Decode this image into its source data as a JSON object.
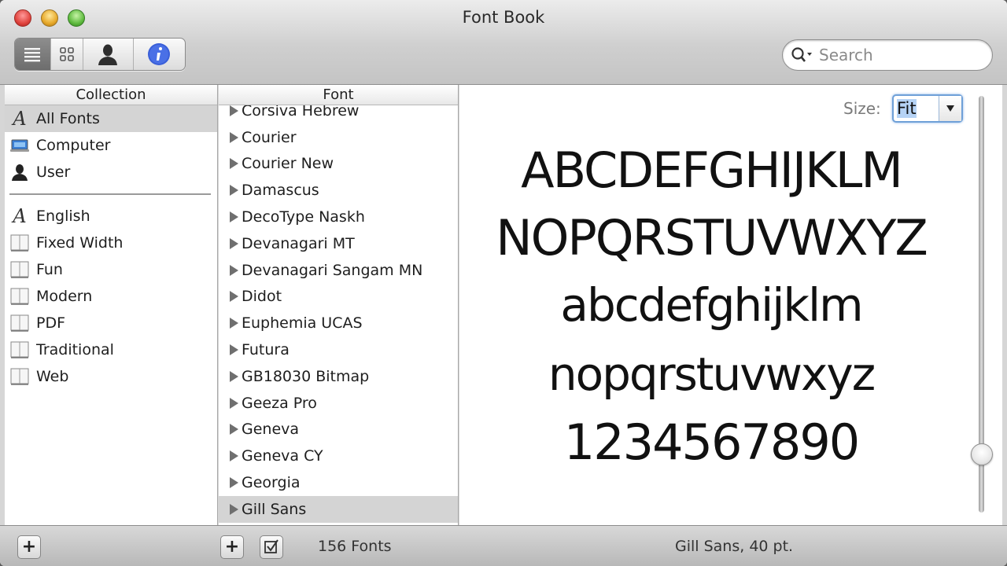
{
  "window": {
    "title": "Font Book"
  },
  "toolbar": {
    "view_buttons": [
      {
        "name": "list-view",
        "icon": "list-icon",
        "active": true
      },
      {
        "name": "grid-view",
        "icon": "grid-icon",
        "active": false
      },
      {
        "name": "user-view",
        "icon": "person-icon",
        "active": false
      },
      {
        "name": "info",
        "icon": "info-icon",
        "active": false
      }
    ],
    "search": {
      "placeholder": "Search",
      "value": ""
    }
  },
  "collection": {
    "header": "Collection",
    "items": [
      {
        "label": "All Fonts",
        "icon": "script-a-icon",
        "selected": true
      },
      {
        "label": "Computer",
        "icon": "computer-icon",
        "selected": false
      },
      {
        "label": "User",
        "icon": "user-icon",
        "selected": false
      }
    ],
    "custom_items": [
      {
        "label": "English",
        "icon": "script-a-icon"
      },
      {
        "label": "Fixed Width",
        "icon": "collection-book-icon"
      },
      {
        "label": "Fun",
        "icon": "collection-book-icon"
      },
      {
        "label": "Modern",
        "icon": "collection-book-icon"
      },
      {
        "label": "PDF",
        "icon": "collection-book-icon"
      },
      {
        "label": "Traditional",
        "icon": "collection-book-icon"
      },
      {
        "label": "Web",
        "icon": "collection-book-icon"
      }
    ]
  },
  "fonts": {
    "header": "Font",
    "items": [
      {
        "label": "Corsiva Hebrew",
        "selected": false
      },
      {
        "label": "Courier",
        "selected": false
      },
      {
        "label": "Courier New",
        "selected": false
      },
      {
        "label": "Damascus",
        "selected": false
      },
      {
        "label": "DecoType Naskh",
        "selected": false
      },
      {
        "label": "Devanagari MT",
        "selected": false
      },
      {
        "label": "Devanagari Sangam MN",
        "selected": false
      },
      {
        "label": "Didot",
        "selected": false
      },
      {
        "label": "Euphemia UCAS",
        "selected": false
      },
      {
        "label": "Futura",
        "selected": false
      },
      {
        "label": "GB18030 Bitmap",
        "selected": false
      },
      {
        "label": "Geeza Pro",
        "selected": false
      },
      {
        "label": "Geneva",
        "selected": false
      },
      {
        "label": "Geneva CY",
        "selected": false
      },
      {
        "label": "Georgia",
        "selected": false
      },
      {
        "label": "Gill Sans",
        "selected": true
      }
    ]
  },
  "preview": {
    "size_label": "Size:",
    "size_value": "Fit",
    "sample_lines": [
      "ABCDEFGHIJKLM",
      "NOPQRSTUVWXYZ",
      "abcdefghijklm",
      "nopqrstuvwxyz",
      "1234567890"
    ],
    "size_slider_fraction": 0.88
  },
  "status": {
    "font_count": "156 Fonts",
    "selected_font_info": "Gill Sans, 40 pt."
  }
}
